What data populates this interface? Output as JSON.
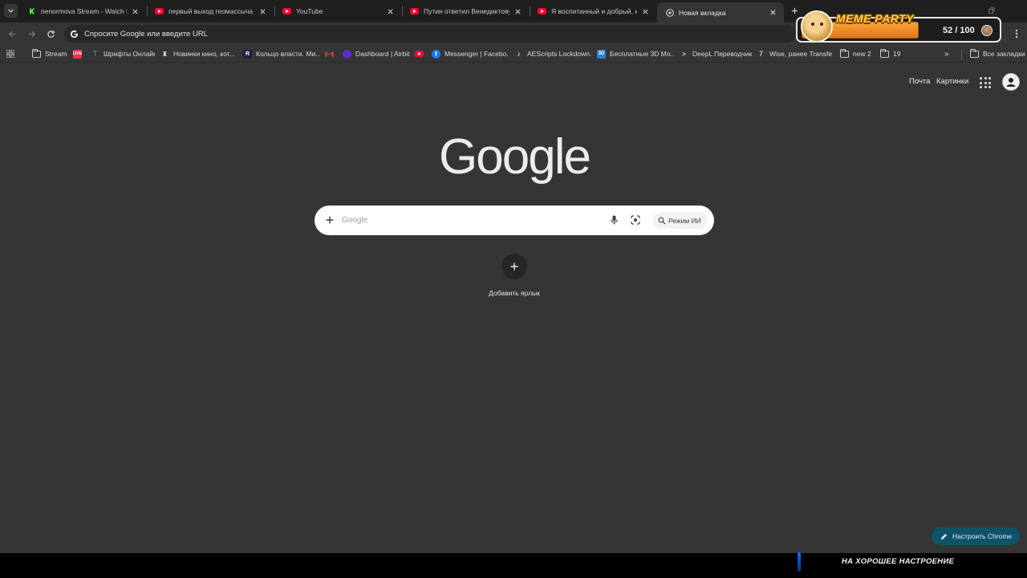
{
  "tabs": [
    {
      "title": "nenormova Stream - Watch Live",
      "favicon": "kick-icon",
      "active": false
    },
    {
      "title": "первый выход геомассыча - YouTube",
      "favicon": "youtube-icon",
      "active": false
    },
    {
      "title": "YouTube",
      "favicon": "youtube-icon",
      "active": false
    },
    {
      "title": "Путин ответил Венедиктову - YouTube",
      "favicon": "youtube-icon",
      "active": false
    },
    {
      "title": "Я воспитанный и добрый, несмотря ни на что",
      "favicon": "youtube-icon",
      "active": false
    },
    {
      "title": "Новая вкладка",
      "favicon": "chrome-icon",
      "active": true
    }
  ],
  "toolbar": {
    "omnibox_text": "Спросите Google или введите URL"
  },
  "overlay": {
    "logo": "MEME PARTY",
    "count": "52 / 100",
    "progress": 0.52
  },
  "bookmarks": [
    {
      "label": "Stream",
      "icon": "folder-icon"
    },
    {
      "label": "",
      "icon": "red-badge-icon"
    },
    {
      "label": "Шрифты Онлайн",
      "icon": "font-site-icon"
    },
    {
      "label": "Новинки кино, кот...",
      "icon": "cinema-site-icon"
    },
    {
      "label": "Кольцо власти. Ми...",
      "icon": "r-site-icon"
    },
    {
      "label": "",
      "icon": "gmail-icon"
    },
    {
      "label": "Dashboard | Airbit",
      "icon": "airbit-icon"
    },
    {
      "label": "",
      "icon": "youtube-icon"
    },
    {
      "label": "Messenger | Facebo...",
      "icon": "facebook-icon"
    },
    {
      "label": "AEScripts Lockdown...",
      "icon": "tiktok-icon"
    },
    {
      "label": "Бесплатные 3D Мо...",
      "icon": "3d-site-icon"
    },
    {
      "label": "DeepL Переводчик",
      "icon": "deepl-icon"
    },
    {
      "label": "Wise, ранее Transfe...",
      "icon": "wise-icon"
    },
    {
      "label": "new 2",
      "icon": "folder-icon"
    },
    {
      "label": "19",
      "icon": "folder-icon"
    }
  ],
  "bookmarks_all": "Все закладки",
  "ntp": {
    "mail_link": "Почта",
    "images_link": "Картинки",
    "logo_text": "Google",
    "search_placeholder": "Google",
    "ai_mode": "Режим ИИ",
    "add_shortcut": "Добавить ярлык",
    "customize": "Настроить Chrome"
  },
  "stream_caption": "НА ХОРОШЕЕ НАСТРОЕНИЕ",
  "colors": {
    "page_bg": "#353535",
    "tabstrip_bg": "#1f1f1f",
    "customize_bg": "#11526b",
    "overlay_bar": "#f9a23a"
  }
}
